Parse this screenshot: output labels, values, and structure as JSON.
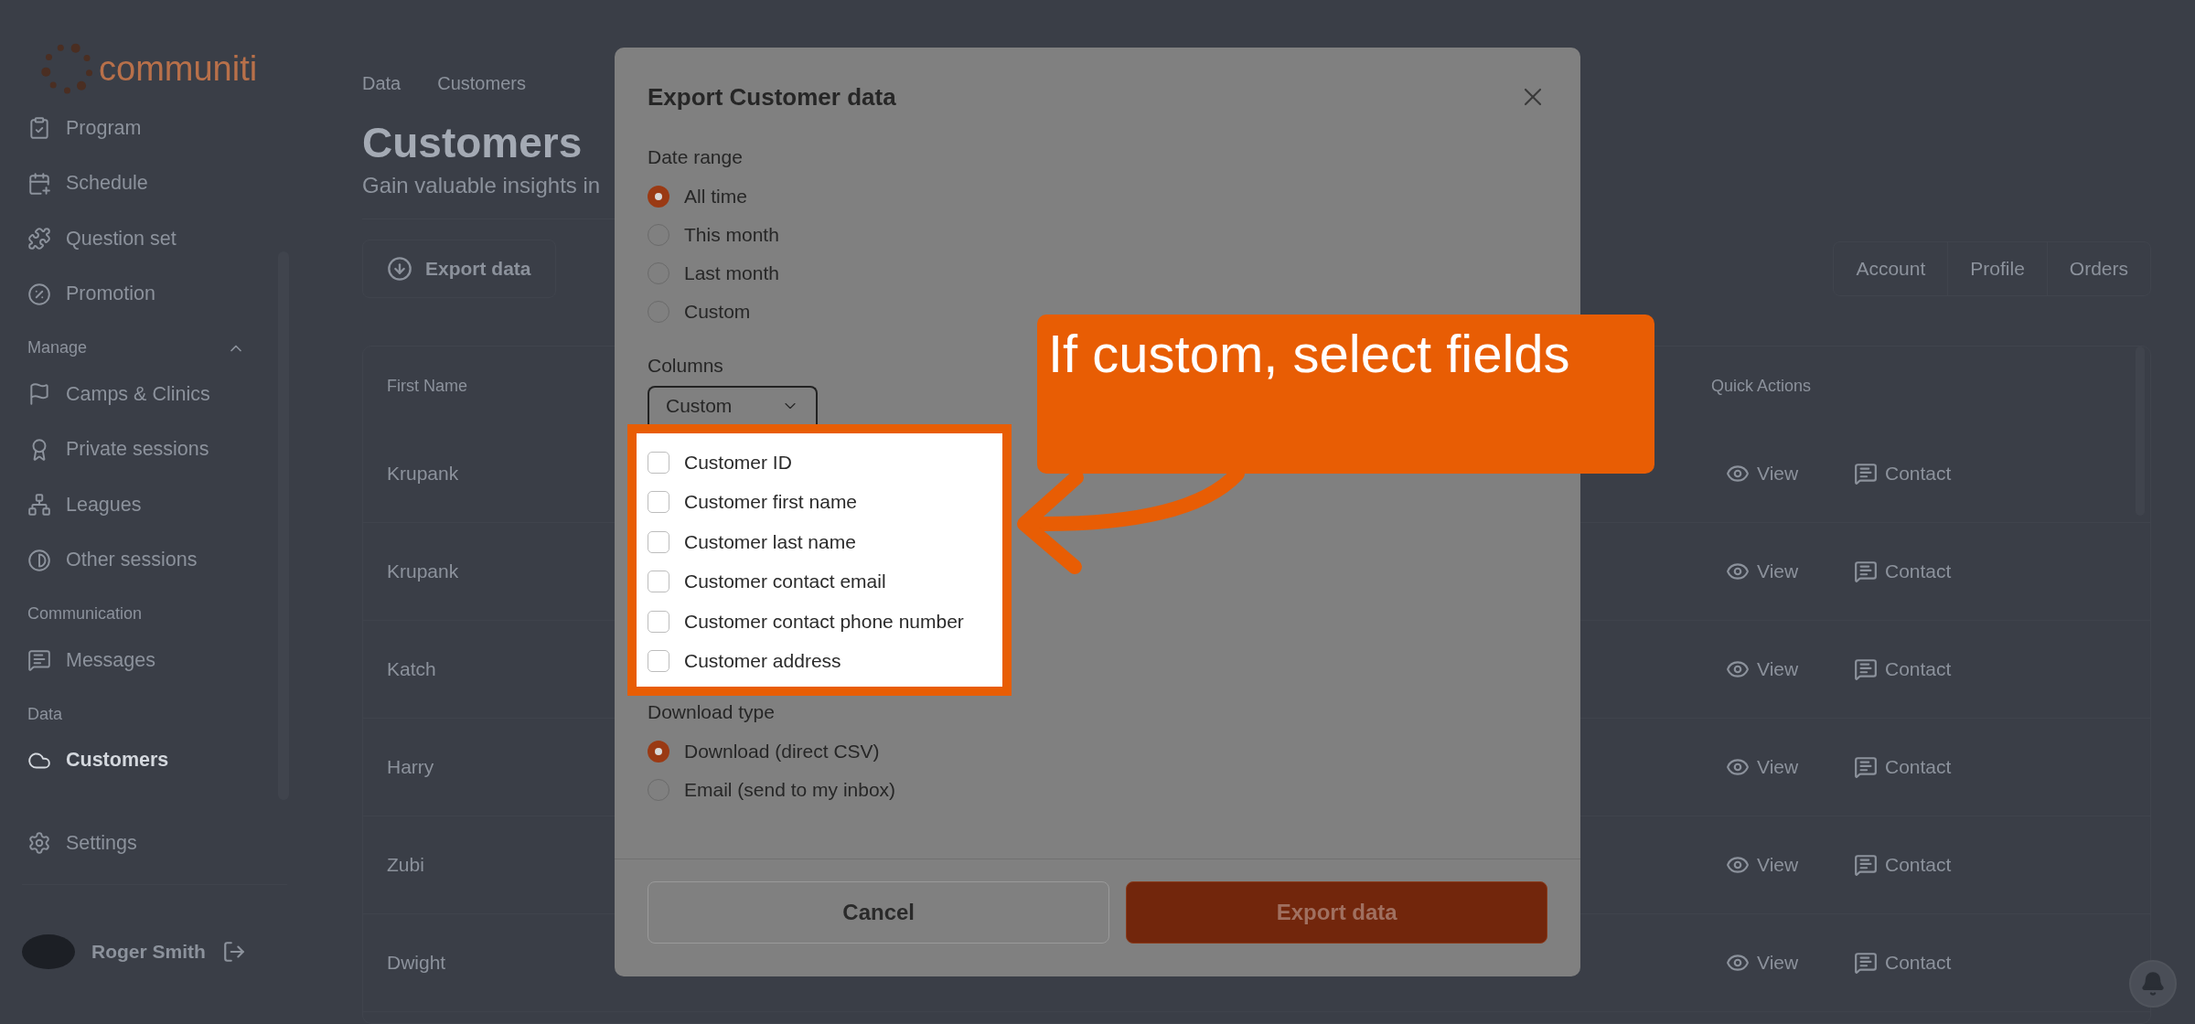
{
  "sidebar": {
    "logo": "communiti",
    "groups": [
      {
        "items": [
          {
            "label": "Program",
            "selected": false
          },
          {
            "label": "Schedule",
            "selected": false
          },
          {
            "label": "Question set",
            "selected": false
          },
          {
            "label": "Promotion",
            "selected": false
          }
        ]
      },
      {
        "heading": "Manage",
        "expanded": true,
        "items": [
          {
            "label": "Camps & Clinics",
            "selected": false
          },
          {
            "label": "Private sessions",
            "selected": false
          },
          {
            "label": "Leagues",
            "selected": false
          },
          {
            "label": "Other sessions",
            "selected": false
          }
        ]
      },
      {
        "heading": "Communication",
        "items": [
          {
            "label": "Messages",
            "selected": false
          }
        ]
      },
      {
        "heading": "Data",
        "items": [
          {
            "label": "Customers",
            "selected": true
          }
        ]
      }
    ],
    "settings": "Settings",
    "user": {
      "name": "Roger Smith"
    }
  },
  "breadcrumb": [
    "Data",
    "Customers"
  ],
  "page": {
    "title": "Customers",
    "subtitle": "Gain valuable insights in",
    "export_button": "Export data"
  },
  "tabs": [
    {
      "label": "Account",
      "selected": false
    },
    {
      "label": "Profile",
      "selected": false
    },
    {
      "label": "Orders",
      "selected": false
    }
  ],
  "table": {
    "columns": [
      "First Name",
      "Quick Actions"
    ],
    "rows": [
      {
        "first_name": "Krupank",
        "view": "View",
        "contact": "Contact"
      },
      {
        "first_name": "Krupank",
        "view": "View",
        "contact": "Contact"
      },
      {
        "first_name": "Katch",
        "view": "View",
        "contact": "Contact"
      },
      {
        "first_name": "Harry",
        "view": "View",
        "contact": "Contact"
      },
      {
        "first_name": "Zubi",
        "view": "View",
        "contact": "Contact"
      },
      {
        "first_name": "Dwight",
        "view": "View",
        "contact": "Contact"
      }
    ]
  },
  "dialog": {
    "title": "Export Customer data",
    "date_range": {
      "label": "Date range",
      "options": [
        {
          "label": "All time",
          "selected": true
        },
        {
          "label": "This month",
          "selected": false
        },
        {
          "label": "Last month",
          "selected": false
        },
        {
          "label": "Custom",
          "selected": false
        }
      ]
    },
    "columns": {
      "label": "Columns",
      "value": "Custom",
      "fields": [
        {
          "label": "Customer ID",
          "checked": false
        },
        {
          "label": "Customer first name",
          "checked": false
        },
        {
          "label": "Customer last name",
          "checked": false
        },
        {
          "label": "Customer contact email",
          "checked": false
        },
        {
          "label": "Customer contact phone number",
          "checked": false
        },
        {
          "label": "Customer address",
          "checked": false
        }
      ]
    },
    "download_type": {
      "label": "Download type",
      "options": [
        {
          "label": "Download (direct CSV)",
          "selected": true
        },
        {
          "label": "Email (send to my inbox)",
          "selected": false
        }
      ]
    },
    "buttons": {
      "cancel": "Cancel",
      "confirm": "Export data"
    }
  },
  "callout": {
    "text": "If custom, select fields"
  }
}
